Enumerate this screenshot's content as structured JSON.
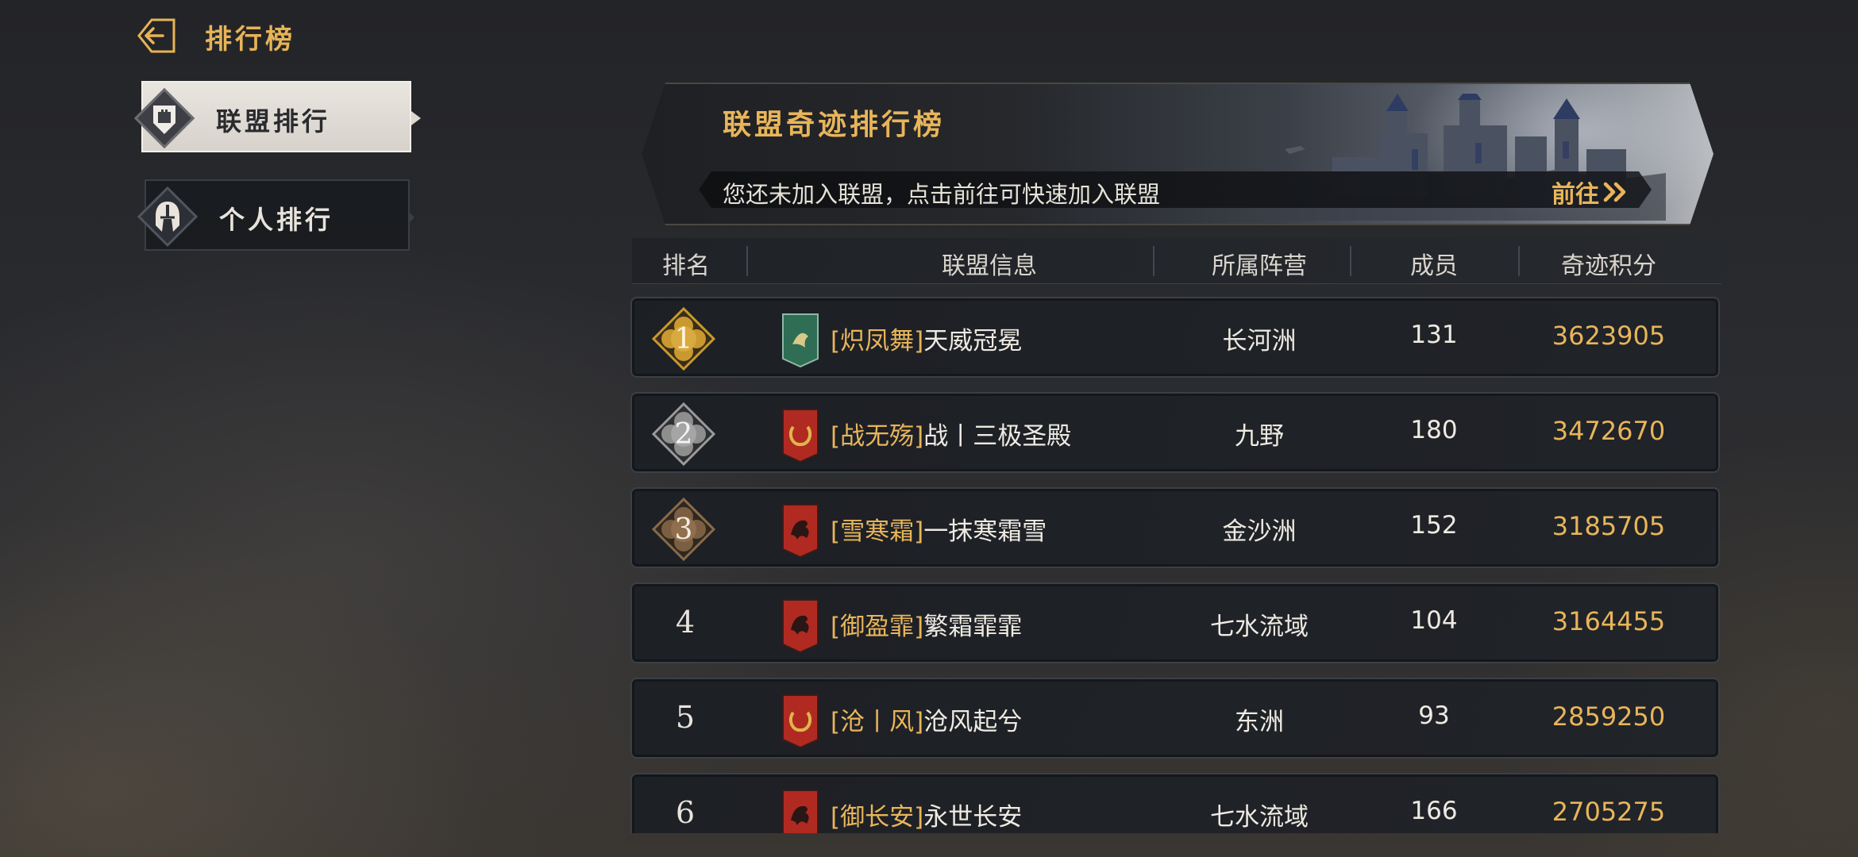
{
  "header": {
    "title": "排行榜",
    "back_icon": "back-arrow-icon"
  },
  "sidebar": {
    "tabs": [
      {
        "label": "联盟排行",
        "icon": "castle-shield-icon",
        "active": true
      },
      {
        "label": "个人排行",
        "icon": "spartan-helmet-icon",
        "active": false
      }
    ]
  },
  "banner": {
    "title": "联盟奇迹排行榜",
    "hint": "您还未加入联盟，点击前往可快速加入联盟",
    "goto_label": "前往",
    "goto_icon": "double-chevron-right-icon"
  },
  "table": {
    "columns": [
      "排名",
      "联盟信息",
      "所属阵营",
      "成员",
      "奇迹积分"
    ],
    "rows": [
      {
        "rank": "1",
        "tag": "[炽凤舞]",
        "name": "天威冠冕",
        "camp": "长河洲",
        "members": "131",
        "score": "3623905",
        "flag": "green-phoenix-flag-icon"
      },
      {
        "rank": "2",
        "tag": "[战无殇]",
        "name": "战丨三极圣殿",
        "camp": "九野",
        "members": "180",
        "score": "3472670",
        "flag": "red-laurel-flag-icon"
      },
      {
        "rank": "3",
        "tag": "[雪寒霜]",
        "name": "一抹寒霜雪",
        "camp": "金沙洲",
        "members": "152",
        "score": "3185705",
        "flag": "red-dragon-flag-icon"
      },
      {
        "rank": "4",
        "tag": "[御盈霏]",
        "name": "繁霜霏霏",
        "camp": "七水流域",
        "members": "104",
        "score": "3164455",
        "flag": "red-dragon-flag-icon"
      },
      {
        "rank": "5",
        "tag": "[沧丨风]",
        "name": "沧风起兮",
        "camp": "东洲",
        "members": "93",
        "score": "2859250",
        "flag": "red-laurel-flag-icon"
      },
      {
        "rank": "6",
        "tag": "[御长安]",
        "name": "永世长安",
        "camp": "七水流域",
        "members": "166",
        "score": "2705275",
        "flag": "red-dragon-flag-icon"
      }
    ]
  },
  "colors": {
    "gold_text": "#e8b55a",
    "rank1_badge": "#c9982f",
    "rank2_badge": "#9a9a9a",
    "rank3_badge": "#8a6a48",
    "green_flag": "#2f6d55",
    "red_flag": "#b02a22"
  }
}
